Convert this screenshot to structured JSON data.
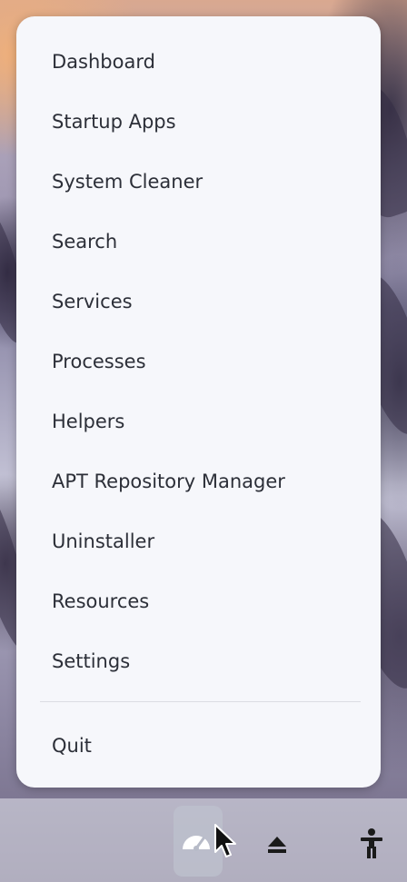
{
  "menu": {
    "items": [
      {
        "label": "Dashboard"
      },
      {
        "label": "Startup Apps"
      },
      {
        "label": "System Cleaner"
      },
      {
        "label": "Search"
      },
      {
        "label": "Services"
      },
      {
        "label": "Processes"
      },
      {
        "label": "Helpers"
      },
      {
        "label": "APT Repository Manager"
      },
      {
        "label": "Uninstaller"
      },
      {
        "label": "Resources"
      },
      {
        "label": "Settings"
      }
    ],
    "quit_label": "Quit"
  },
  "tray": {
    "icons": [
      "speedometer-icon",
      "eject-icon",
      "accessibility-icon"
    ]
  },
  "colors": {
    "popup_bg": "#f6f7fb",
    "text": "#2c2f38",
    "separator": "#dcdde3"
  }
}
